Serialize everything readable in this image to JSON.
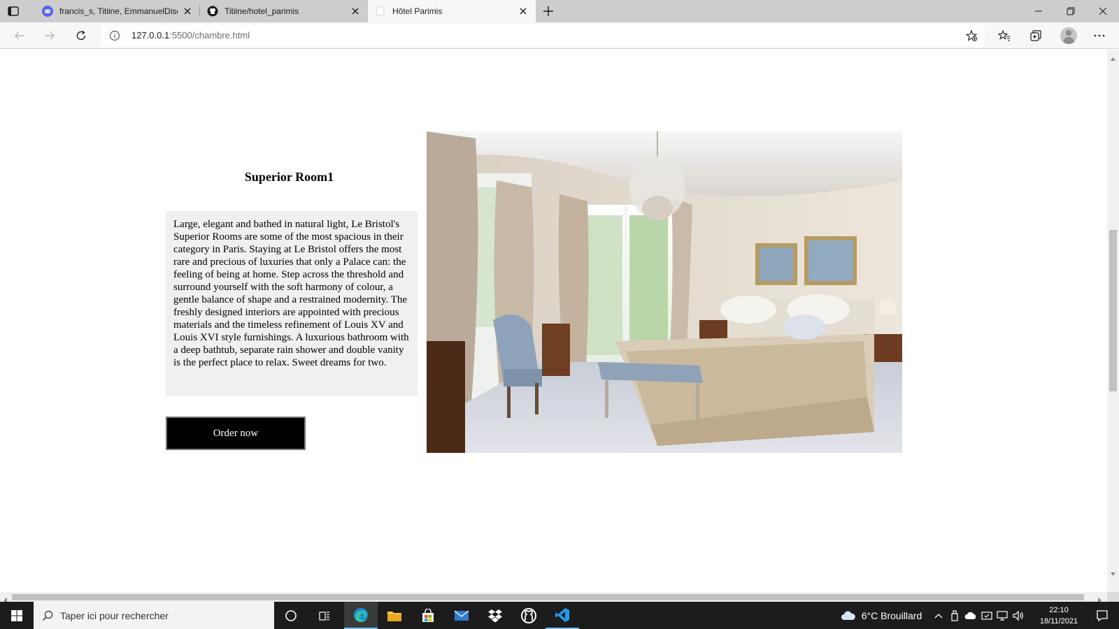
{
  "browser": {
    "tabs": [
      {
        "title": "francis_s, Titiine, EmmanuelDisco",
        "favicon": "discord-icon",
        "active": false
      },
      {
        "title": "Titiine/hotel_parimis",
        "favicon": "github-icon",
        "active": false
      },
      {
        "title": "Hôtel Parimis",
        "favicon": "page-icon",
        "active": true
      }
    ],
    "url_host": "127.0.0.1",
    "url_path": ":5500/chambre.html"
  },
  "page": {
    "room_title": "Superior Room1",
    "room_description": "Large, elegant and bathed in natural light, Le Bristol's Superior Rooms are some of the most spacious in their category in Paris. Staying at Le Bristol offers the most rare and precious of luxuries that only a Palace can: the feeling of being at home. Step across the threshold and surround yourself with the soft harmony of colour, a gentle balance of shape and a restrained modernity. The freshly designed interiors are appointed with precious materials and the timeless refinement of Louis XV and Louis XVI style furnishings. A luxurious bathroom with a deep bathtub, separate rain shower and double vanity is the perfect place to relax. Sweet dreams for two.",
    "order_button": "Order now"
  },
  "taskbar": {
    "search_placeholder": "Taper ici pour rechercher",
    "weather": "6°C  Brouillard",
    "time": "22:10",
    "date": "18/11/2021"
  }
}
